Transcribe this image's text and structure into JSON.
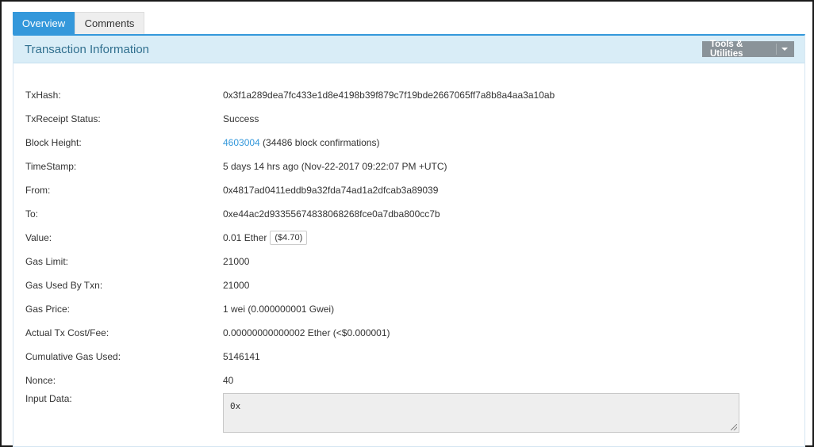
{
  "tabs": [
    {
      "label": "Overview",
      "active": true
    },
    {
      "label": "Comments",
      "active": false
    }
  ],
  "panel": {
    "title": "Transaction Information",
    "tools_label": "Tools & Utilities"
  },
  "fields": {
    "txhash": {
      "label": "TxHash:",
      "value": "0x3f1a289dea7fc433e1d8e4198b39f879c7f19bde2667065ff7a8b8a4aa3a10ab"
    },
    "status": {
      "label": "TxReceipt Status:",
      "value": "Success"
    },
    "block": {
      "label": "Block Height:",
      "link": "4603004",
      "suffix": " (34486 block confirmations)"
    },
    "timestamp": {
      "label": "TimeStamp:",
      "value": "5 days 14 hrs ago (Nov-22-2017 09:22:07 PM +UTC)"
    },
    "from": {
      "label": "From:",
      "value": "0x4817ad0411eddb9a32fda74ad1a2dfcab3a89039"
    },
    "to": {
      "label": "To:",
      "value": "0xe44ac2d93355674838068268fce0a7dba800cc7b"
    },
    "value": {
      "label": "Value:",
      "value": "0.01 Ether",
      "usd": "($4.70)"
    },
    "gas_limit": {
      "label": "Gas Limit:",
      "value": "21000"
    },
    "gas_used": {
      "label": "Gas Used By Txn:",
      "value": "21000"
    },
    "gas_price": {
      "label": "Gas Price:",
      "value": "1 wei (0.000000001 Gwei)"
    },
    "fee": {
      "label": "Actual Tx Cost/Fee:",
      "value": "0.00000000000002 Ether (<$0.000001)"
    },
    "cumulative": {
      "label": "Cumulative Gas Used:",
      "value": "5146141"
    },
    "nonce": {
      "label": "Nonce:",
      "value": "40"
    },
    "input": {
      "label": "Input Data:",
      "value": "0x"
    }
  },
  "colors": {
    "accent": "#3498db",
    "header_bg": "#d9edf7",
    "title": "#31708f",
    "success": "#3c763d",
    "tools_bg": "#8a9399"
  },
  "icons": {
    "tools_caret": "chevron-down-icon",
    "resize": "resize-grip-icon"
  }
}
